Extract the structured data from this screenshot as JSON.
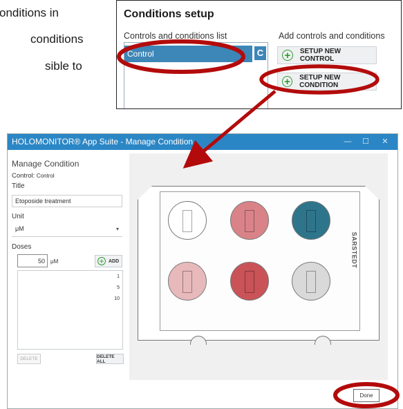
{
  "fragments": {
    "line1": "onditions in",
    "line2": "conditions",
    "line3": "sible to"
  },
  "setup": {
    "title": "Conditions setup",
    "list_label": "Controls and conditions list",
    "add_label": "Add controls and conditions",
    "items": [
      {
        "label": "Control",
        "badge": "C"
      }
    ],
    "setup_control_label": "SETUP NEW CONTROL",
    "setup_condition_label": "SETUP NEW CONDITION"
  },
  "window": {
    "title": "HOLOMONITOR® App Suite - Manage Condition",
    "minimize": "—",
    "maximize": "☐",
    "close": "✕"
  },
  "panel": {
    "heading": "Manage Condition",
    "control_prefix": "Control:",
    "control_value": "Control",
    "title_label": "Title",
    "title_value": "Etoposide treatment",
    "unit_label": "Unit",
    "unit_value": "μM",
    "doses_label": "Doses",
    "dose_value": "50",
    "dose_unit": "μM",
    "add_label": "ADD",
    "doses": [
      "1",
      "5",
      "10"
    ],
    "delete_label": "DELETE",
    "delete_all_label": "DELETE ALL"
  },
  "plate": {
    "brand": "SARSTEDT",
    "wells": [
      {
        "color": "#ffffff"
      },
      {
        "color": "#d98388"
      },
      {
        "color": "#2e758c"
      },
      {
        "color": "#e8b9bb"
      },
      {
        "color": "#c95357"
      },
      {
        "color": "#d9d9d9"
      }
    ]
  },
  "done_label": "Done",
  "colors": {
    "titlebar": "#2b86c5",
    "selected": "#3d86b8",
    "annotation": "#b30b0b",
    "add_green": "#2e9b2e"
  }
}
